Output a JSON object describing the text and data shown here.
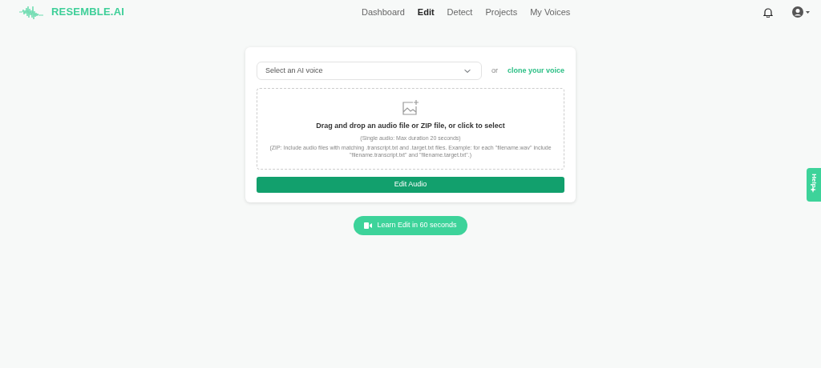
{
  "brand": {
    "name": "RESEMBLE.AI"
  },
  "nav": [
    {
      "label": "Dashboard",
      "selected": false
    },
    {
      "label": "Edit",
      "selected": true
    },
    {
      "label": "Detect",
      "selected": false
    },
    {
      "label": "Projects",
      "selected": false
    },
    {
      "label": "My Voices",
      "selected": false
    }
  ],
  "voice_select": {
    "placeholder": "Select an AI voice"
  },
  "or_text": "or",
  "clone_link": "clone your voice",
  "dropzone": {
    "title": "Drag and drop an audio file or ZIP file, or click to select",
    "hint": "(Single audio: Max duration 20 seconds)",
    "note": "(ZIP: Include audio files with matching .transcript.txt and .target.txt files. Example: for each \"filename.wav\" include \"filename.transcript.txt\" and \"filename.target.txt\".)"
  },
  "submit_button": "Edit Audio",
  "learn_button": "Learn Edit in 60 seconds",
  "help_tab": "Help"
}
